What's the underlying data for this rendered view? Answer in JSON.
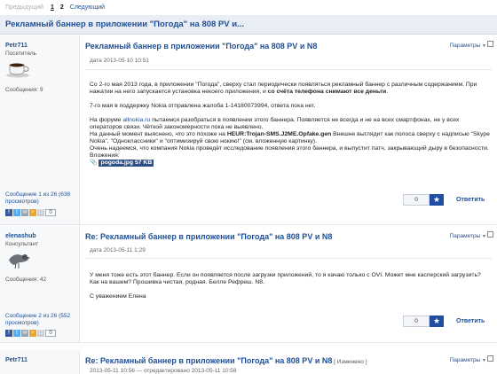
{
  "pager": {
    "prev": "Предыдущий",
    "pages": [
      "1",
      "2"
    ],
    "next": "Следующий"
  },
  "thread_title": "Рекламный баннер в приложении \"Погода\" на 808 PV и...",
  "posts": [
    {
      "author": "Petr711",
      "rank": "Посетитель",
      "messages": "Сообщения: 9",
      "title": "Рекламный баннер в приложении \"Погода\" на 808 PV и N8",
      "date": "дата 2013-05-10 10:51",
      "options": "Параметры",
      "p1_a": "Со 2-го мая 2013 года, в приложении \"Погода\", сверху стал периодически появляться рекламный баннер с различным содержанием. При нажатии на него запускается установка некоего приложения, и ",
      "p1_b": "со счёта телефона снимают все деньги",
      "p1_c": ".",
      "p2": "7-го мая в поддержку Nokia отправлена жалоба 1-14180073994, ответа пока нет.",
      "p3_a": "На форуме ",
      "p3_link": "allnokia.ru",
      "p3_b": " пытаемся разобраться в появлении этого баннера. Появляется не всегда и не на всех смартфонах, не у всех операторов связи. Чёткой закономерности пока не выявлено.",
      "p4_a": "На данный момент выяснено, что это похоже на ",
      "p4_b": "HEUR:Trojan-SMS.J2ME.Opfake.gen",
      "p4_c": " Внешне выглядит как полоса сверху с надписью \"Skype Nokia\", \"Одноклассники\" и \"оптимизируй свою нокию!\" (см. вложенную картинку).",
      "p5": "Очень надеемся, что компания Nokia проведёт исследование появления этого баннера, и выпустит патч, закрывающий дыру в безопасности.",
      "attachments_label": "Вложения:",
      "attachment": "pogoda.jpg 57 KB",
      "postnum_a": "Сообщение ",
      "postnum_n": "1",
      "postnum_b": " из 26 (636 просмотров)",
      "votes": "0",
      "reply": "Ответить",
      "rating": "0"
    },
    {
      "author": "elenashub",
      "rank": "Консультант",
      "messages": "Сообщения: 42",
      "title": "Re: Рекламный баннер в приложении \"Погода\" на 808 PV и N8",
      "date": "дата 2013-05-11 1:29",
      "options": "Параметры",
      "p1": "У меня тоже есть этот баннер. Если он появляется после загрузки приложений, то я качаю только с OVI. Может мне касперский загрузить? Как на вашем? Прошивка чистая, родная. Белле Рефреш. N8.",
      "p2": "С уважением Елена",
      "postnum_a": "Сообщение ",
      "postnum_n": "2",
      "postnum_b": " из 26 (552 просмотров)",
      "votes": "0",
      "reply": "Ответить",
      "rating": "0"
    },
    {
      "author": "Petr711",
      "title": "Re: Рекламный баннер в приложении \"Погода\" на 808 PV и N8",
      "edited": " [ Изменено ]",
      "date": "2013-05-11 10:56 — отредактировано 2013-05-11 10:58",
      "options": "Параметры"
    }
  ],
  "colors": {
    "accent": "#1e4f96",
    "header_bg": "#e9eef4",
    "star_bg": "#1f4ea3"
  },
  "icons": [
    "coffee-cup-avatar",
    "pigeon-avatar",
    "paperclip-icon",
    "star-icon",
    "checkbox"
  ]
}
